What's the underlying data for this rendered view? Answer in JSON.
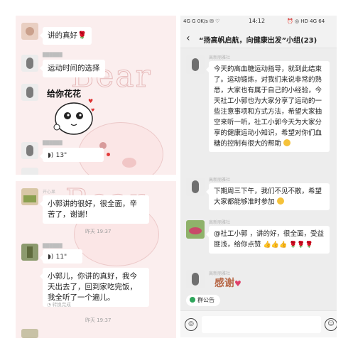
{
  "left_top": {
    "messages": [
      {
        "text": "讲的真好🌹"
      },
      {
        "text": "运动时间的选择"
      },
      {
        "voice": "13\""
      }
    ],
    "sticker_text": "给你花花"
  },
  "left_bottom": {
    "nick": "开心果",
    "msg1": "小郭讲的很好，很全面，辛苦了，谢谢!",
    "time1": "昨天 19:37",
    "voice2": "11\"",
    "msg3": "小郭儿，你讲的真好，我今天出去了，回到家吃完饭，我全听了一个遍儿。",
    "note3": "转换完成",
    "time3": "昨天 19:37"
  },
  "statusbar": {
    "left": "4G  G   0K/s  ✉  ♡",
    "time": "14:12",
    "right": "⏰  ◎  HD  4G  64"
  },
  "chat": {
    "title": "“扬高帆启航，向健康出发”小组(23)",
    "messages": [
      {
        "text": "今天的高血糖运动指导，就到此结束了。运动锻炼，对我们来说非常的熟悉，大家也有属于自己的小经验，今天社工小郭也为大家分享了运动的一些注意事项和方式方法，希望大家抽空来听一听，社工小郭今天为大家分享的健康运动小知识，希望对你们血糖的控制有很大的帮助"
      },
      {
        "text": "下期周三下午，我们不见不散，希望大家都能够准时参加"
      },
      {
        "text": "@社工小郭 ，讲的好，很全面，受益匪浅，给你点赞"
      },
      {
        "text": "感谢"
      }
    ],
    "nick": "高新丽雅社"
  },
  "announcement": "群公告",
  "input": {
    "voice": "◎",
    "emoji": "☺"
  }
}
